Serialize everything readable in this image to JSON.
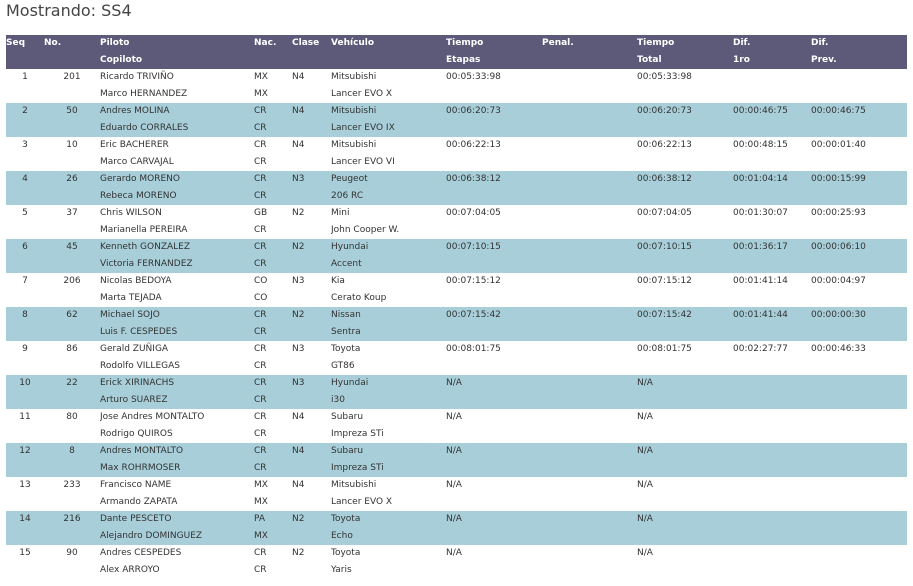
{
  "title": "Mostrando: SS4",
  "headers": {
    "seq": "Seq",
    "no": "No.",
    "piloto": "Piloto",
    "copiloto": "Copiloto",
    "nac": "Nac.",
    "clase": "Clase",
    "vehiculo": "Vehículo",
    "tiempo1": "Tiempo",
    "etapas": "Etapas",
    "penal": "Penal.",
    "tiempo2": "Tiempo",
    "total": "Total",
    "dif1": "Dif.",
    "dif1b": "1ro",
    "dif2": "Dif.",
    "dif2b": "Prev."
  },
  "rows": [
    {
      "seq": "1",
      "no": "201",
      "piloto": "Ricardo TRIVIÑO",
      "nac1": "MX",
      "clase": "N4",
      "veh1": "Mitsubishi",
      "tiempo": "00:05:33:98",
      "penal": "",
      "total": "00:05:33:98",
      "dif1": "",
      "dif2": "",
      "copiloto": "Marco HERNANDEZ",
      "nac2": "MX",
      "veh2": "Lancer EVO X"
    },
    {
      "seq": "2",
      "no": "50",
      "piloto": "Andres MOLINA",
      "nac1": "CR",
      "clase": "N4",
      "veh1": "Mitsubishi",
      "tiempo": "00:06:20:73",
      "penal": "",
      "total": "00:06:20:73",
      "dif1": "00:00:46:75",
      "dif2": "00:00:46:75",
      "copiloto": "Eduardo CORRALES",
      "nac2": "CR",
      "veh2": "Lancer EVO IX"
    },
    {
      "seq": "3",
      "no": "10",
      "piloto": "Eric BACHERER",
      "nac1": "CR",
      "clase": "N4",
      "veh1": "Mitsubishi",
      "tiempo": "00:06:22:13",
      "penal": "",
      "total": "00:06:22:13",
      "dif1": "00:00:48:15",
      "dif2": "00:00:01:40",
      "copiloto": "Marco CARVAJAL",
      "nac2": "CR",
      "veh2": "Lancer EVO VI"
    },
    {
      "seq": "4",
      "no": "26",
      "piloto": "Gerardo MORENO",
      "nac1": "CR",
      "clase": "N3",
      "veh1": "Peugeot",
      "tiempo": "00:06:38:12",
      "penal": "",
      "total": "00:06:38:12",
      "dif1": "00:01:04:14",
      "dif2": "00:00:15:99",
      "copiloto": "Rebeca MORENO",
      "nac2": "CR",
      "veh2": "206 RC"
    },
    {
      "seq": "5",
      "no": "37",
      "piloto": "Chris WILSON",
      "nac1": "GB",
      "clase": "N2",
      "veh1": "Mini",
      "tiempo": "00:07:04:05",
      "penal": "",
      "total": "00:07:04:05",
      "dif1": "00:01:30:07",
      "dif2": "00:00:25:93",
      "copiloto": "Marianella PEREIRA",
      "nac2": "CR",
      "veh2": "John Cooper W."
    },
    {
      "seq": "6",
      "no": "45",
      "piloto": "Kenneth GONZALEZ",
      "nac1": "CR",
      "clase": "N2",
      "veh1": "Hyundai",
      "tiempo": "00:07:10:15",
      "penal": "",
      "total": "00:07:10:15",
      "dif1": "00:01:36:17",
      "dif2": "00:00:06:10",
      "copiloto": "Victoria FERNANDEZ",
      "nac2": "CR",
      "veh2": "Accent"
    },
    {
      "seq": "7",
      "no": "206",
      "piloto": "Nicolas BEDOYA",
      "nac1": "CO",
      "clase": "N3",
      "veh1": "Kia",
      "tiempo": "00:07:15:12",
      "penal": "",
      "total": "00:07:15:12",
      "dif1": "00:01:41:14",
      "dif2": "00:00:04:97",
      "copiloto": "Marta TEJADA",
      "nac2": "CO",
      "veh2": "Cerato Koup"
    },
    {
      "seq": "8",
      "no": "62",
      "piloto": "Michael SOJO",
      "nac1": "CR",
      "clase": "N2",
      "veh1": "Nissan",
      "tiempo": "00:07:15:42",
      "penal": "",
      "total": "00:07:15:42",
      "dif1": "00:01:41:44",
      "dif2": "00:00:00:30",
      "copiloto": "Luis F. CESPEDES",
      "nac2": "CR",
      "veh2": "Sentra"
    },
    {
      "seq": "9",
      "no": "86",
      "piloto": "Gerald ZUÑIGA",
      "nac1": "CR",
      "clase": "N3",
      "veh1": "Toyota",
      "tiempo": "00:08:01:75",
      "penal": "",
      "total": "00:08:01:75",
      "dif1": "00:02:27:77",
      "dif2": "00:00:46:33",
      "copiloto": "Rodolfo VILLEGAS",
      "nac2": "CR",
      "veh2": "GT86"
    },
    {
      "seq": "10",
      "no": "22",
      "piloto": "Erick XIRINACHS",
      "nac1": "CR",
      "clase": "N3",
      "veh1": "Hyundai",
      "tiempo": "N/A",
      "penal": "",
      "total": "N/A",
      "dif1": "",
      "dif2": "",
      "copiloto": "Arturo SUAREZ",
      "nac2": "CR",
      "veh2": "i30"
    },
    {
      "seq": "11",
      "no": "80",
      "piloto": "Jose Andres MONTALTO",
      "nac1": "CR",
      "clase": "N4",
      "veh1": "Subaru",
      "tiempo": "N/A",
      "penal": "",
      "total": "N/A",
      "dif1": "",
      "dif2": "",
      "copiloto": "Rodrigo QUIROS",
      "nac2": "CR",
      "veh2": "Impreza STi"
    },
    {
      "seq": "12",
      "no": "8",
      "piloto": "Andres MONTALTO",
      "nac1": "CR",
      "clase": "N4",
      "veh1": "Subaru",
      "tiempo": "N/A",
      "penal": "",
      "total": "N/A",
      "dif1": "",
      "dif2": "",
      "copiloto": "Max ROHRMOSER",
      "nac2": "CR",
      "veh2": "Impreza STi"
    },
    {
      "seq": "13",
      "no": "233",
      "piloto": "Francisco NAME",
      "nac1": "MX",
      "clase": "N4",
      "veh1": "Mitsubishi",
      "tiempo": "N/A",
      "penal": "",
      "total": "N/A",
      "dif1": "",
      "dif2": "",
      "copiloto": "Armando ZAPATA",
      "nac2": "MX",
      "veh2": "Lancer EVO X"
    },
    {
      "seq": "14",
      "no": "216",
      "piloto": "Dante PESCETO",
      "nac1": "PA",
      "clase": "N2",
      "veh1": "Toyota",
      "tiempo": "N/A",
      "penal": "",
      "total": "N/A",
      "dif1": "",
      "dif2": "",
      "copiloto": "Alejandro DOMINGUEZ",
      "nac2": "MX",
      "veh2": "Echo"
    },
    {
      "seq": "15",
      "no": "90",
      "piloto": "Andres CESPEDES",
      "nac1": "CR",
      "clase": "N2",
      "veh1": "Toyota",
      "tiempo": "N/A",
      "penal": "",
      "total": "N/A",
      "dif1": "",
      "dif2": "",
      "copiloto": "Alex ARROYO",
      "nac2": "CR",
      "veh2": "Yaris"
    }
  ]
}
